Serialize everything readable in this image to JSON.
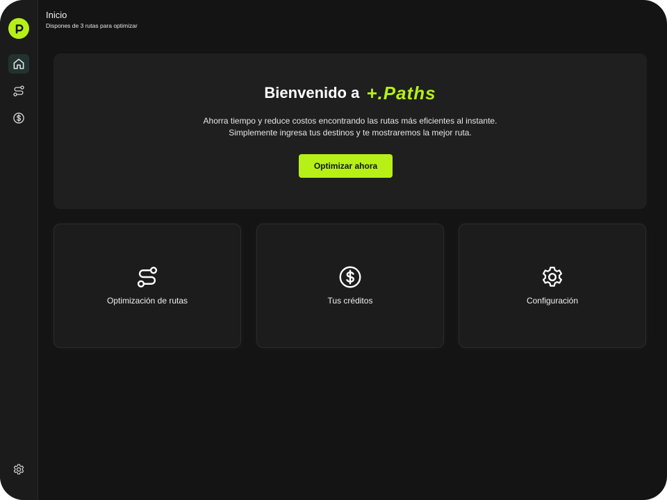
{
  "header": {
    "title": "Inicio",
    "subtitle": "Dispones de 3 rutas para optimizar"
  },
  "sidebar": {
    "logo_letter": "p",
    "items": [
      {
        "name": "home",
        "icon": "home-icon",
        "active": true
      },
      {
        "name": "routes",
        "icon": "route-icon",
        "active": false
      },
      {
        "name": "credits",
        "icon": "dollar-coin-icon",
        "active": false
      }
    ],
    "bottom_item": {
      "name": "settings",
      "icon": "gear-icon"
    }
  },
  "hero": {
    "title_prefix": "Bienvenido a",
    "brand": "+.Paths",
    "line1": "Ahorra tiempo y reduce costos encontrando las rutas más eficientes al instante.",
    "line2": "Simplemente ingresa tus destinos y te mostraremos la mejor ruta.",
    "cta_label": "Optimizar ahora"
  },
  "cards": [
    {
      "label": "Optimización de rutas",
      "icon": "route-icon"
    },
    {
      "label": "Tus créditos",
      "icon": "dollar-coin-icon"
    },
    {
      "label": "Configuración",
      "icon": "gear-icon"
    }
  ],
  "colors": {
    "accent": "#b6f016",
    "background": "#141414",
    "panel": "#1f1f1f",
    "active_nav": "#22332f"
  }
}
